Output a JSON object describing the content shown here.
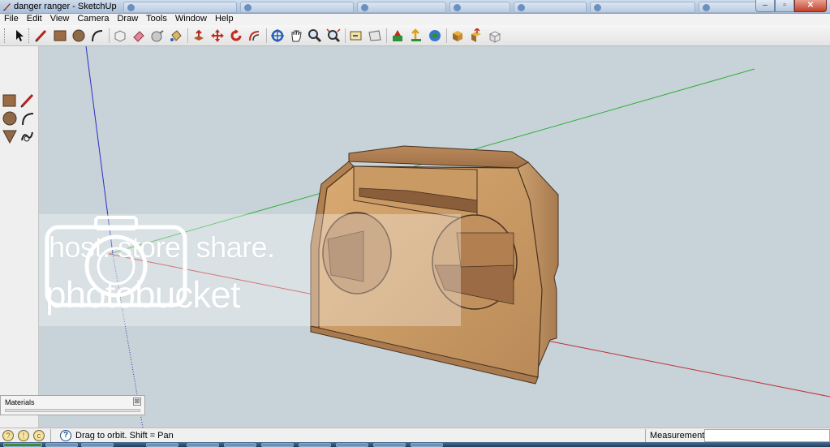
{
  "window": {
    "title": "danger ranger - SketchUp",
    "background_tabs": [
      "",
      "",
      "",
      "",
      "",
      "",
      ""
    ],
    "minimize": "–",
    "maximize": "▫",
    "close": "✕"
  },
  "menu": [
    "File",
    "Edit",
    "View",
    "Camera",
    "Draw",
    "Tools",
    "Window",
    "Help"
  ],
  "toolbar": {
    "tools": [
      "select-icon",
      "line-icon",
      "rectangle-icon",
      "circle-icon",
      "arc-icon",
      "make-component-icon",
      "eraser-icon",
      "tape-measure-icon",
      "paint-bucket-icon",
      "push-pull-icon",
      "move-icon",
      "rotate-icon",
      "offset-icon",
      "orbit-icon",
      "pan-icon",
      "zoom-icon",
      "zoom-extents-icon",
      "previous-view-icon",
      "next-view-icon",
      "add-location-icon",
      "toggle-terrain-icon",
      "photo-textures-icon",
      "get-models-icon",
      "share-model-icon",
      "share-component-icon"
    ]
  },
  "left_tools": [
    "rectangle-icon",
    "line-icon",
    "circle-icon",
    "arc-icon",
    "polygon-icon",
    "freehand-icon"
  ],
  "watermark": {
    "line1": "host. store. share.",
    "line2": "photobucket"
  },
  "materials_panel": {
    "title": "Materials",
    "close": "⊠"
  },
  "status": {
    "hint": "Drag to orbit.  Shift = Pan",
    "measurements_label": "Measurements",
    "measurements_value": ""
  },
  "colors": {
    "sky": "#c7d3d8",
    "wood": "#c99a64",
    "x_axis": "#c0303a",
    "y_axis": "#2fae3c",
    "z_axis": "#2b2fc2"
  }
}
